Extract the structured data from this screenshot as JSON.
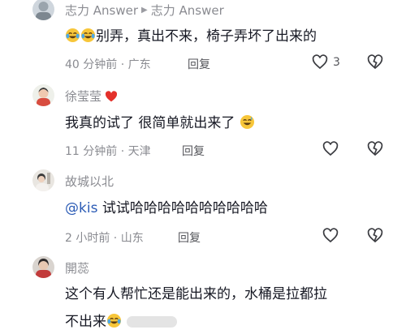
{
  "comments": [
    {
      "author": "志力 Answer",
      "reply_to": "志力 Answer",
      "text": "别弄，真出不来，椅子弄坏了出来的",
      "time": "40 分钟前",
      "location": "广东",
      "reply_label": "回复",
      "likes": "3"
    },
    {
      "author": "徐莹莹",
      "text": "我真的试了 很简单就出来了",
      "time": "11 分钟前",
      "location": "天津",
      "reply_label": "回复"
    },
    {
      "author": "故城以北",
      "mention": "@kis",
      "text": " 试试哈哈哈哈哈哈哈哈哈哈",
      "time": "2 小时前",
      "location": "山东",
      "reply_label": "回复"
    },
    {
      "author": "開蕊",
      "text_line1": "这个有人帮忙还是能出来的，水桶是拉都拉",
      "text_line2": "不出来"
    }
  ],
  "meta_separator": " · ",
  "colors": {
    "meta": "#8a8b91",
    "mention": "#2b5bb5",
    "text": "#161823"
  },
  "icons": [
    "avatar",
    "reply-arrow-icon",
    "crying-laughing-emoji",
    "heart-icon",
    "dislike-heart-icon",
    "sweat-smile-emoji"
  ]
}
